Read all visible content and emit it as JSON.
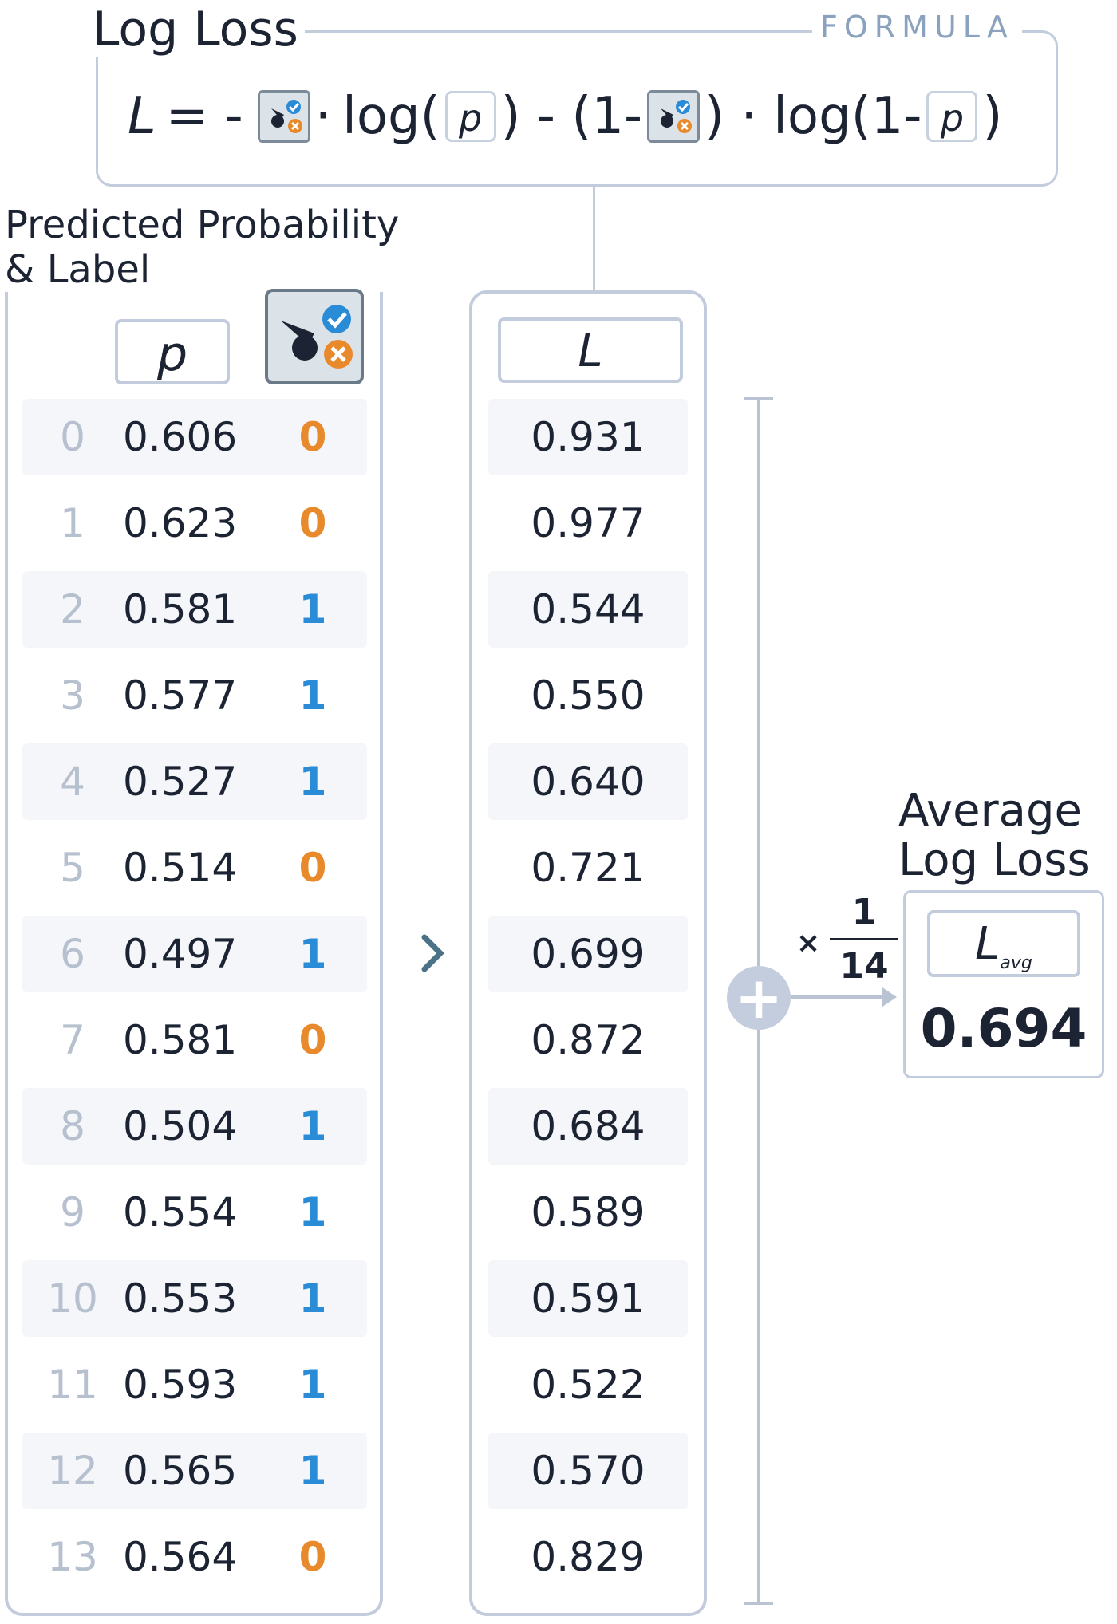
{
  "formula": {
    "title": "Log Loss",
    "tag": "FORMULA",
    "lhs": "L",
    "eq": "= -",
    "dot1": "·",
    "log_open": "log(",
    "p": "p",
    "close_mid": ") - (1-",
    "close_mid2": ") · log(1-",
    "close_end": ")"
  },
  "left_panel": {
    "title_line1": "Predicted Probability",
    "title_line2": "& Label",
    "p_header": "p"
  },
  "mid_panel": {
    "header": "L"
  },
  "rows": [
    {
      "idx": "0",
      "p": "0.606",
      "label": "0",
      "loss": "0.931"
    },
    {
      "idx": "1",
      "p": "0.623",
      "label": "0",
      "loss": "0.977"
    },
    {
      "idx": "2",
      "p": "0.581",
      "label": "1",
      "loss": "0.544"
    },
    {
      "idx": "3",
      "p": "0.577",
      "label": "1",
      "loss": "0.550"
    },
    {
      "idx": "4",
      "p": "0.527",
      "label": "1",
      "loss": "0.640"
    },
    {
      "idx": "5",
      "p": "0.514",
      "label": "0",
      "loss": "0.721"
    },
    {
      "idx": "6",
      "p": "0.497",
      "label": "1",
      "loss": "0.699"
    },
    {
      "idx": "7",
      "p": "0.581",
      "label": "0",
      "loss": "0.872"
    },
    {
      "idx": "8",
      "p": "0.504",
      "label": "1",
      "loss": "0.684"
    },
    {
      "idx": "9",
      "p": "0.554",
      "label": "1",
      "loss": "0.589"
    },
    {
      "idx": "10",
      "p": "0.553",
      "label": "1",
      "loss": "0.591"
    },
    {
      "idx": "11",
      "p": "0.593",
      "label": "1",
      "loss": "0.522"
    },
    {
      "idx": "12",
      "p": "0.565",
      "label": "1",
      "loss": "0.570"
    },
    {
      "idx": "13",
      "p": "0.564",
      "label": "0",
      "loss": "0.829"
    }
  ],
  "summation": {
    "plus": "+",
    "times": "×",
    "frac_num": "1",
    "frac_den": "14"
  },
  "average": {
    "title_line1": "Average",
    "title_line2": "Log Loss",
    "header_main": "L",
    "header_sub": "avg",
    "value": "0.694"
  },
  "colors": {
    "label_0": "#e8892c",
    "label_1": "#2a8bd6",
    "box_border": "#c3ccdd"
  },
  "icons": {
    "label_icon": "golf-label-icon",
    "chevron": "chevron-right-icon"
  }
}
